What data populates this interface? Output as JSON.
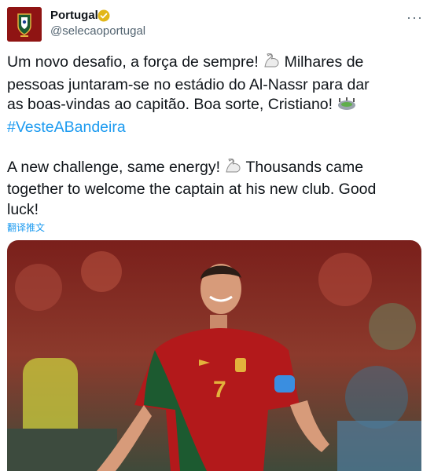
{
  "account": {
    "display_name": "Portugal",
    "handle": "@selecaoportugal",
    "avatar_icon": "fpf-crest-icon",
    "verified_icon": "verified-badge-icon"
  },
  "menu": {
    "more_label": "···"
  },
  "tweet": {
    "pt_line1": "Um novo desafio, a força de sempre!",
    "pt_line1b": "Milhares de",
    "pt_line2": "pessoas juntaram-se no estádio do Al-Nassr para dar",
    "pt_line3": "as boas-vindas ao capitão. Boa sorte, Cristiano!",
    "hashtag": "#VesteABandeira",
    "en_line1": "A new challenge, same energy!",
    "en_line1b": "Thousands came",
    "en_line2": "together to welcome the captain at his new club. Good",
    "en_line3": "luck!"
  },
  "translate_label": "翻译推文",
  "media": {
    "jersey_number": "7"
  },
  "colors": {
    "accent": "#1d9bf0",
    "text": "#0f1419",
    "muted": "#536471",
    "jersey_red": "#b3191b",
    "jersey_green": "#1c5a30"
  }
}
